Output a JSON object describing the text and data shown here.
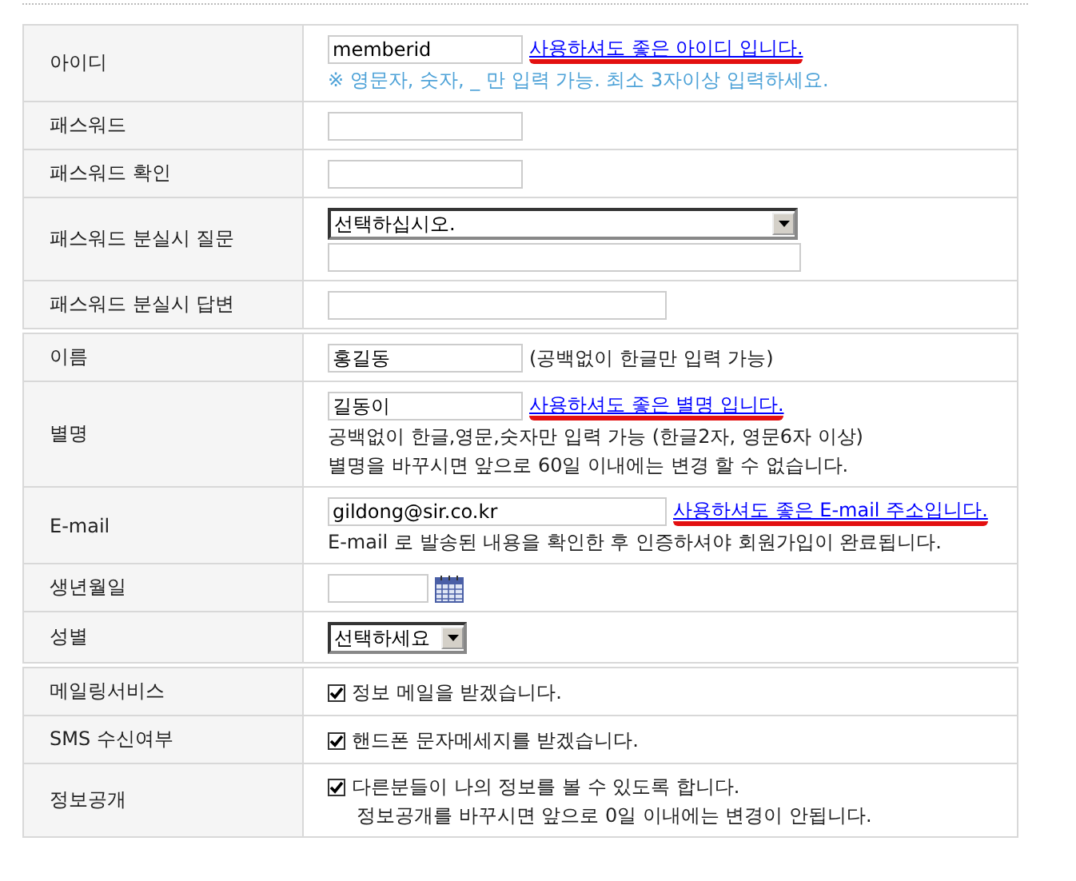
{
  "sections": [
    {
      "rows": [
        {
          "label": "아이디",
          "lines": [
            [
              {
                "kind": "input",
                "value": "memberid"
              },
              {
                "kind": "valid",
                "text": "사용하셔도 좋은 아이디 입니다."
              }
            ],
            [
              {
                "kind": "hint",
                "text": "※ 영문자, 숫자, _ 만 입력 가능. 최소 3자이상 입력하세요."
              }
            ]
          ]
        },
        {
          "label": "패스워드",
          "lines": [
            [
              {
                "kind": "input"
              }
            ]
          ]
        },
        {
          "label": "패스워드 확인",
          "lines": [
            [
              {
                "kind": "input"
              }
            ]
          ]
        },
        {
          "label": "패스워드 분실시 질문",
          "lines": [
            [
              {
                "kind": "wide-select",
                "value": "선택하십시오."
              }
            ],
            [
              {
                "kind": "wide-input"
              }
            ]
          ]
        },
        {
          "label": "패스워드 분실시 답변",
          "lines": [
            [
              {
                "kind": "long-input"
              }
            ]
          ]
        }
      ]
    },
    {
      "rows": [
        {
          "label": "이름",
          "lines": [
            [
              {
                "kind": "input",
                "value": "홍길동"
              },
              {
                "kind": "text",
                "text": "(공백없이 한글만 입력 가능)"
              }
            ]
          ]
        },
        {
          "label": "별명",
          "lines": [
            [
              {
                "kind": "input",
                "value": "길동이"
              },
              {
                "kind": "valid",
                "text": "사용하셔도 좋은 별명 입니다."
              }
            ],
            [
              {
                "kind": "text",
                "text": "공백없이 한글,영문,숫자만 입력 가능 (한글2자, 영문6자 이상)"
              }
            ],
            [
              {
                "kind": "text",
                "text": "별명을 바꾸시면 앞으로 60일 이내에는 변경 할 수 없습니다."
              }
            ]
          ]
        },
        {
          "label": "E-mail",
          "lines": [
            [
              {
                "kind": "long-input",
                "value": "gildong@sir.co.kr"
              },
              {
                "kind": "valid",
                "text": "사용하셔도 좋은 E-mail 주소입니다."
              }
            ],
            [
              {
                "kind": "text",
                "text": "E-mail 로 발송된 내용을 확인한 후 인증하셔야 회원가입이 완료됩니다."
              }
            ]
          ]
        },
        {
          "label": "생년월일",
          "lines": [
            [
              {
                "kind": "date-input"
              },
              {
                "kind": "calendar"
              }
            ]
          ]
        },
        {
          "label": "성별",
          "lines": [
            [
              {
                "kind": "select",
                "value": "선택하세요"
              }
            ]
          ]
        }
      ]
    },
    {
      "rows": [
        {
          "label": "메일링서비스",
          "lines": [
            [
              {
                "kind": "checkbox",
                "checked": true,
                "text": "정보 메일을 받겠습니다."
              }
            ]
          ]
        },
        {
          "label": "SMS 수신여부",
          "lines": [
            [
              {
                "kind": "checkbox",
                "checked": true,
                "text": "핸드폰 문자메세지를 받겠습니다."
              }
            ]
          ]
        },
        {
          "label": "정보공개",
          "lines": [
            [
              {
                "kind": "checkbox",
                "checked": true,
                "text": "다른분들이 나의 정보를 볼 수 있도록 합니다."
              }
            ],
            [
              {
                "kind": "note",
                "text": "정보공개를 바꾸시면 앞으로 0일 이내에는 변경이 안됩니다."
              }
            ]
          ]
        }
      ]
    }
  ]
}
